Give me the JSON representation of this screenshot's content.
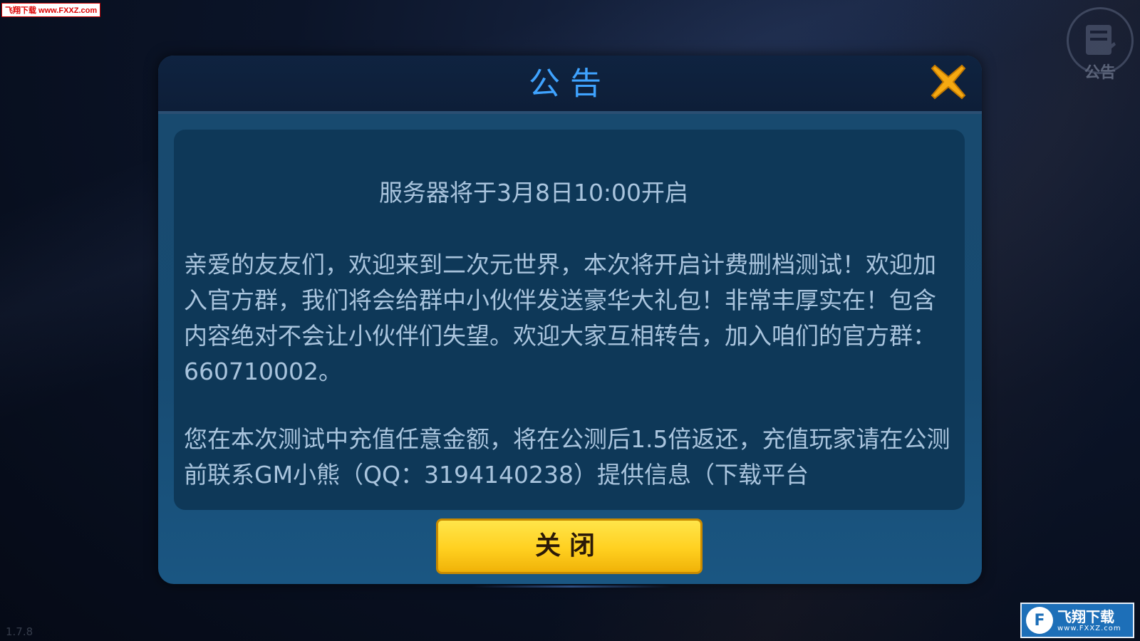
{
  "watermark_top": "飞翔下载 www.FXXZ.com",
  "top_notice": {
    "label": "公告",
    "icon": "notice-board-icon"
  },
  "version": "1.7.8",
  "logo": {
    "main": "飞翔下载",
    "sub": "www.FXXZ.com",
    "mark": "F"
  },
  "dialog": {
    "title": "公告",
    "close_icon": "close-x-icon",
    "headline": "服务器将于3月8日10:00开启",
    "paragraph1": "亲爱的友友们，欢迎来到二次元世界，本次将开启计费删档测试！欢迎加入官方群，我们将会给群中小伙伴发送豪华大礼包！非常丰厚实在！包含内容绝对不会让小伙伴们失望。欢迎大家互相转告，加入咱们的官方群：660710002。",
    "paragraph2": "您在本次测试中充值任意金额，将在公测后1.5倍返还，充值玩家请在公测前联系GM小熊（QQ：3194140238）提供信息（下载平台",
    "close_button": "关闭"
  },
  "colors": {
    "title_blue": "#3fa3ff",
    "close_x_orange": "#f5a912",
    "button_yellow": "#ffd020",
    "text_light": "#a9c4dd"
  }
}
